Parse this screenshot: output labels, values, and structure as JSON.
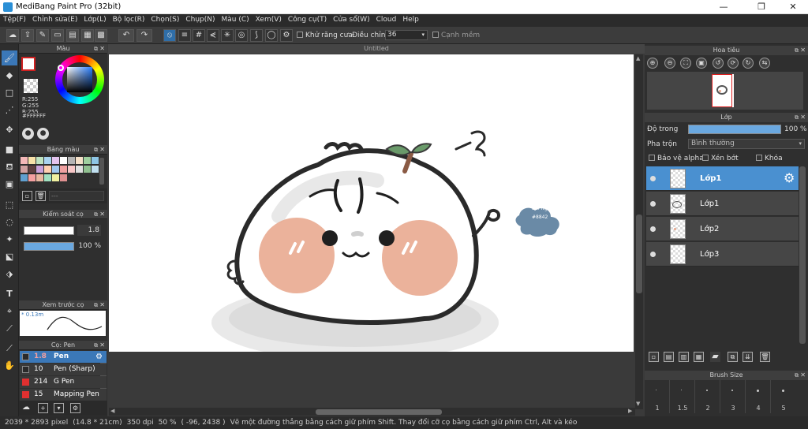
{
  "window": {
    "title": "MediBang Paint Pro (32bit)",
    "minimize": "—",
    "restore": "❐",
    "close": "✕"
  },
  "menu": [
    "Tệp(F)",
    "Chỉnh sửa(E)",
    "Lớp(L)",
    "Bộ lọc(R)",
    "Chọn(S)",
    "Chụp(N)",
    "Màu (C)",
    "Xem(V)",
    "Công cụ(T)",
    "Cửa sổ(W)",
    "Cloud",
    "Help"
  ],
  "toolbar": {
    "antialias_label": "Khử răng cưa",
    "adjust_label": "Điều chỉnh",
    "adjust_value": "36",
    "smooth_label": "Cạnh mềm"
  },
  "color_panel": {
    "title": "Màu",
    "r": "R:255",
    "g": "G:255",
    "b": "B:255",
    "hex": "#FFFFFF"
  },
  "palette_panel": {
    "title": "Bảng màu",
    "colors": [
      "#f4b8b8",
      "#f7e1a8",
      "#bfe3c0",
      "#a9d3ef",
      "#e4c4ef",
      "#ffffff",
      "#b4b4b4",
      "#f4e0c8",
      "#9fcf9f",
      "#8ec6e6",
      "#d0a0a0",
      "#604040",
      "#c9a0d9",
      "#ffd0b0",
      "#a0c8f0",
      "#f0a0a0",
      "#f8c8c8",
      "#e0e0e0",
      "#90c090",
      "#c0e0f0",
      "#60a0d0",
      "#f4a0a0",
      "#e8b8a0",
      "#a0e0c0",
      "#f0f0a0",
      "#e09090"
    ]
  },
  "brush_control": {
    "title": "Kiểm soát cọ",
    "size": "1.8",
    "opacity": "100 %"
  },
  "brush_preview": {
    "title": "Xem trước cọ",
    "size": "0.13m"
  },
  "brush_list": {
    "title": "Cọ: Pen",
    "items": [
      {
        "size": "1.8",
        "name": "Pen",
        "color": "#2a2a2a",
        "selected": true
      },
      {
        "size": "10",
        "name": "Pen (Sharp)",
        "color": "#2a2a2a",
        "selected": false
      },
      {
        "size": "214",
        "name": "G Pen",
        "color": "#e03030",
        "selected": false
      },
      {
        "size": "15",
        "name": "Mapping Pen",
        "color": "#e03030",
        "selected": false
      }
    ]
  },
  "document": {
    "tab": "Untitled"
  },
  "navigator": {
    "title": "Hoa tiêu"
  },
  "layer_panel": {
    "title": "Lớp",
    "opacity_label": "Độ trong",
    "opacity_value": "100 %",
    "blend_label": "Pha trộn",
    "blend_value": "Bình thường",
    "protect_alpha": "Bảo vệ alpha",
    "clipping": "Xén bớt",
    "lock": "Khóa",
    "layers": [
      {
        "name": "Lớp1",
        "selected": true
      },
      {
        "name": "Lớp1",
        "selected": false
      },
      {
        "name": "Lớp2",
        "selected": false
      },
      {
        "name": "Lớp3",
        "selected": false
      }
    ]
  },
  "brush_size_panel": {
    "title": "Brush Size",
    "sizes": [
      "1",
      "1.5",
      "2",
      "3",
      "4",
      "5"
    ]
  },
  "artwork": {
    "sign_line1": "Bùi Ngân",
    "sign_line2": "#8842"
  },
  "status": {
    "dimensions": "2039 * 2893 pixel",
    "physical": "(14.8 * 21cm)",
    "dpi": "350 dpi",
    "zoom": "50 %",
    "coords": "( -96, 2438 )",
    "hint": "Vẽ một đường thẳng bằng cách giữ phím Shift. Thay đổi cỡ cọ bằng cách giữ phím Ctrl, Alt và kéo"
  },
  "colors": {
    "accent": "#3b78b8",
    "selected_layer": "#4a90d0",
    "blush": "#e8a58a"
  }
}
